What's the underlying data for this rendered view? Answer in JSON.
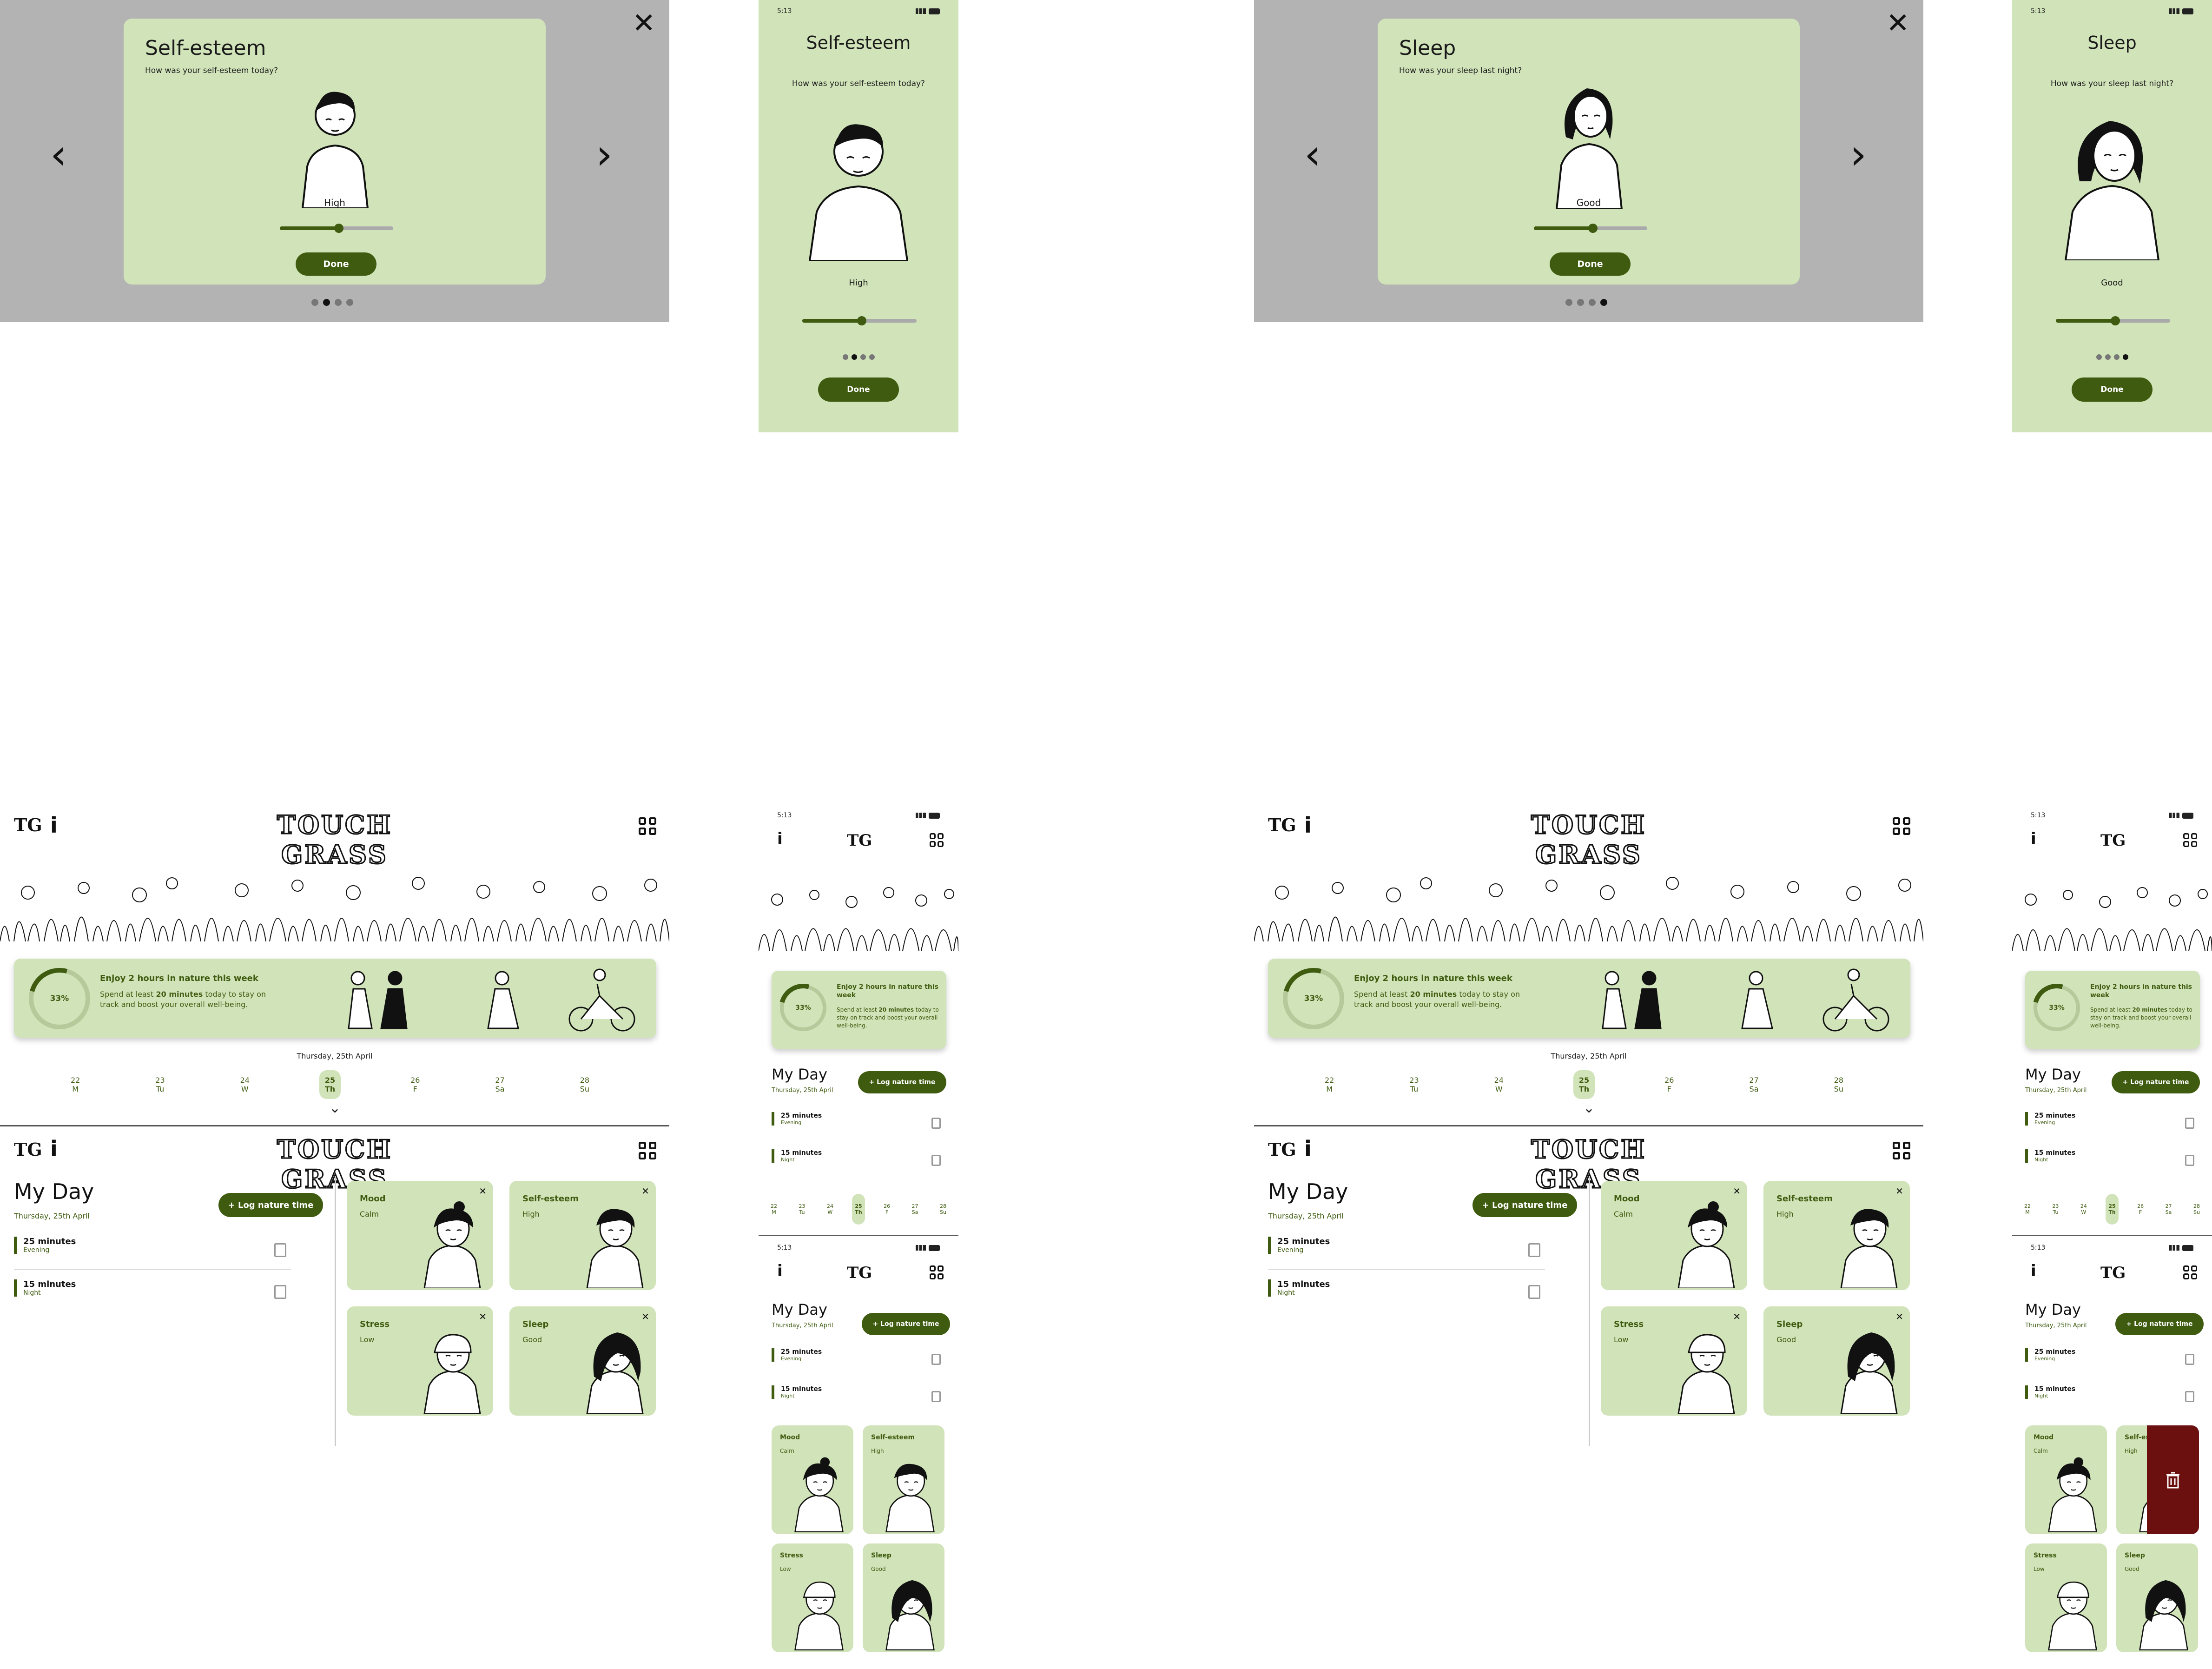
{
  "colors": {
    "accent": "#3e5b0f",
    "card": "#d1e3b9",
    "danger": "#6b0f0f"
  },
  "status": {
    "time": "5:13",
    "battery": "76"
  },
  "app": {
    "name": "TOUCH GRASS",
    "logo_short": "TG",
    "info": "i"
  },
  "modal_selfesteem": {
    "title": "Self-esteem",
    "question": "How was your self-esteem today?",
    "value": "High",
    "done": "Done",
    "slider": 0.52
  },
  "modal_sleep": {
    "title": "Sleep",
    "question": "How was your sleep last night?",
    "value": "Good",
    "done": "Done",
    "slider": 0.52
  },
  "nav": {
    "prev": "‹",
    "next": "›",
    "close": "✕"
  },
  "banner": {
    "percent": "33%",
    "progress": 0.33,
    "title": "Enjoy 2 hours in nature this week",
    "text_pre": "Spend at least ",
    "text_bold": "20 minutes",
    "text_post": " today to stay on track and boost your overall well-being."
  },
  "date_long": "Thursday, 25th April",
  "days": [
    {
      "n": "22",
      "d": "M"
    },
    {
      "n": "23",
      "d": "Tu"
    },
    {
      "n": "24",
      "d": "W"
    },
    {
      "n": "25",
      "d": "Th"
    },
    {
      "n": "26",
      "d": "F"
    },
    {
      "n": "27",
      "d": "Sa"
    },
    {
      "n": "28",
      "d": "Su"
    }
  ],
  "myday": {
    "title": "My Day",
    "date": "Thursday, 25th April",
    "log_button": "+ Log nature time"
  },
  "entries": [
    {
      "duration": "25 minutes",
      "time": "Evening"
    },
    {
      "duration": "15 minutes",
      "time": "Night"
    }
  ],
  "cards": [
    {
      "title": "Mood",
      "value": "Calm"
    },
    {
      "title": "Self-esteem",
      "value": "High"
    },
    {
      "title": "Stress",
      "value": "Low"
    },
    {
      "title": "Sleep",
      "value": "Good"
    }
  ],
  "icons": {
    "chevron_down": "⌄",
    "close_card": "✕",
    "trash": "trash-icon"
  }
}
